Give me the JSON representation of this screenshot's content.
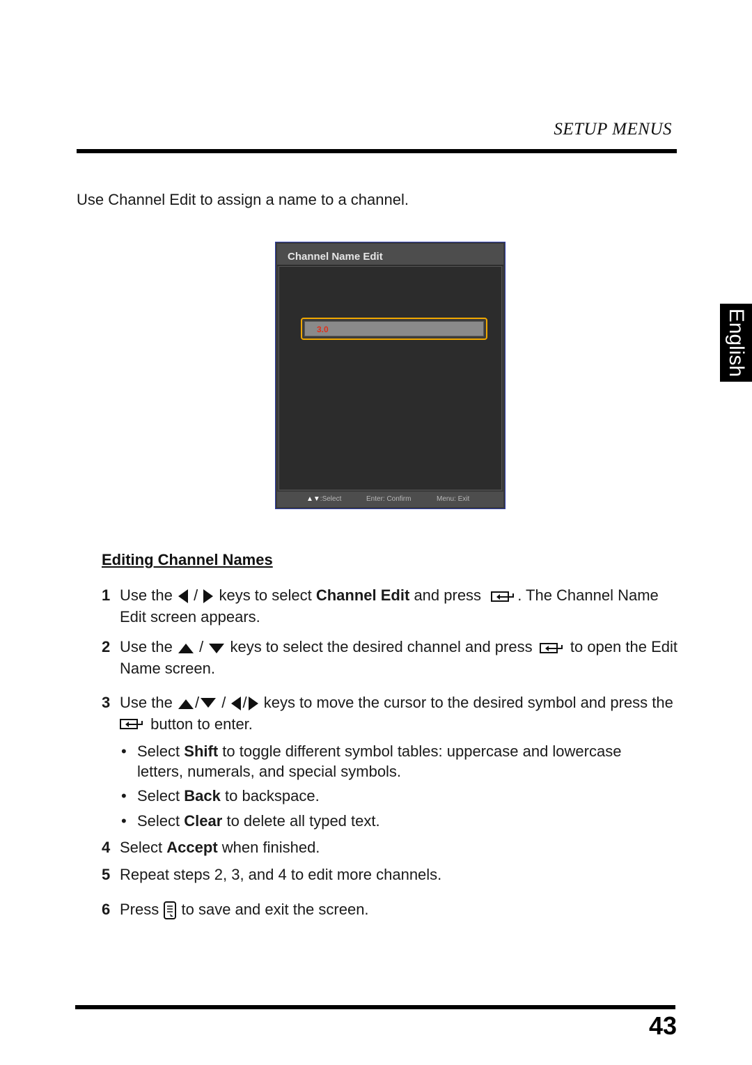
{
  "header": {
    "section_title": "SETUP MENUS"
  },
  "side_tab": {
    "language": "English"
  },
  "intro_text": "Use Channel Edit to assign a name to a channel.",
  "osd": {
    "title": "Channel Name Edit",
    "field_value": "3.0",
    "footer": {
      "select_hint": ":Select",
      "confirm_hint": "Enter: Confirm",
      "exit_hint": "Menu: Exit"
    },
    "colors": {
      "highlight": "#f0a800",
      "field_text": "#e0301a"
    }
  },
  "section_heading": "Editing Channel Names",
  "steps": [
    {
      "num": "1",
      "parts": [
        "Use the",
        "/",
        "keys to select",
        "Channel Edit",
        "and press",
        ". The Channel Name Edit screen appears."
      ]
    },
    {
      "num": "2",
      "parts": [
        "Use the",
        "/",
        "keys to select the desired channel and press",
        "to open the Edit Name screen."
      ]
    },
    {
      "num": "3",
      "parts": [
        "Use the",
        "/",
        "/",
        "/",
        "keys to move the cursor to the desired symbol and press the",
        "button to enter."
      ]
    },
    {
      "num": "4",
      "parts": [
        "Select",
        "Accept",
        "when finished."
      ]
    },
    {
      "num": "5",
      "parts": [
        "Repeat steps 2, 3, and 4 to edit more channels."
      ]
    },
    {
      "num": "6",
      "parts": [
        "Press",
        "to save and exit the screen."
      ]
    }
  ],
  "bullets": [
    {
      "parts": [
        "Select",
        "Shift",
        "to toggle different symbol tables: uppercase and lowercase letters, numerals, and special symbols."
      ]
    },
    {
      "parts": [
        "Select",
        "Back",
        "to backspace."
      ]
    },
    {
      "parts": [
        "Select",
        "Clear",
        "to delete all typed text."
      ]
    }
  ],
  "bullet_char": "•",
  "icons": {
    "left": "left-arrow-icon",
    "right": "right-arrow-icon",
    "up": "up-arrow-icon",
    "down": "down-arrow-icon",
    "enter": "enter-key-icon",
    "menu": "menu-key-icon"
  },
  "page_number": "43"
}
